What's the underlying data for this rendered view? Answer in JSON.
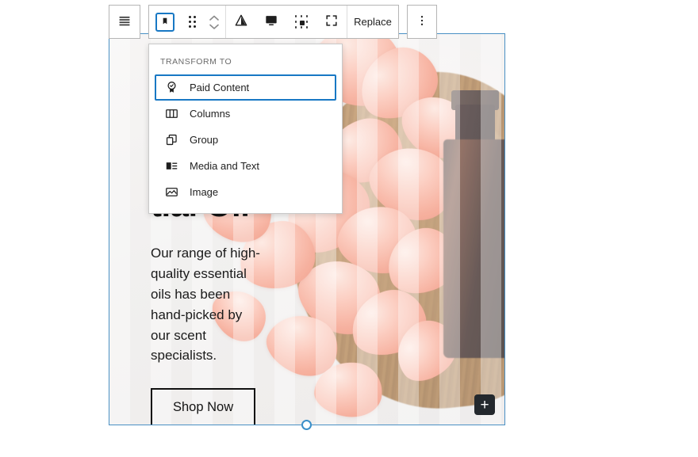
{
  "editor": {
    "toolbar": {
      "list_view_icon": "list-view-icon",
      "block_type_icon": "paid-content-block-icon",
      "drag_handle_icon": "drag-handle-icon",
      "move_up_icon": "chevron-up-icon",
      "move_down_icon": "chevron-down-icon",
      "overlay_icon": "cover-overlay-icon",
      "fullheight_icon": "full-height-toggle-icon",
      "focalpoint_icon": "focal-point-picker-icon",
      "crop_icon": "crop-icon",
      "replace_label": "Replace",
      "more_options_icon": "kebab-menu-icon"
    },
    "dropdown": {
      "section_label": "TRANSFORM TO",
      "items": [
        {
          "label": "Paid Content",
          "icon": "award-ribbon-icon",
          "selected": true
        },
        {
          "label": "Columns",
          "icon": "columns-icon",
          "selected": false
        },
        {
          "label": "Group",
          "icon": "group-icon",
          "selected": false
        },
        {
          "label": "Media and Text",
          "icon": "media-and-text-icon",
          "selected": false
        },
        {
          "label": "Image",
          "icon": "image-icon",
          "selected": false
        }
      ]
    },
    "block": {
      "heading": "Essential Oil",
      "paragraph": "Our range of high-quality essential oils has been hand-picked by our scent specialists.",
      "button_label": "Shop Now",
      "appender_label": "+",
      "selection_color": "#4a90c4",
      "accent_color": "#1878c4"
    }
  }
}
